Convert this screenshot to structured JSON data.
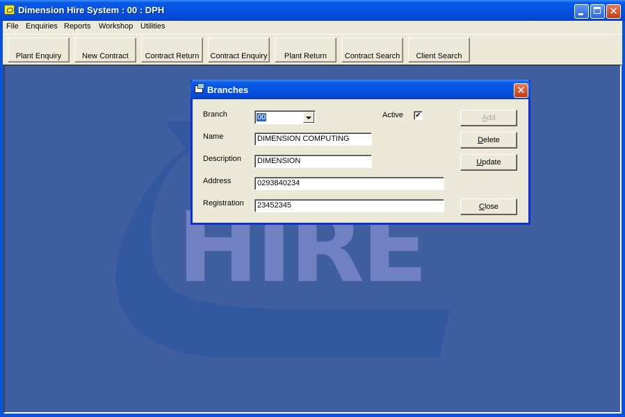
{
  "window": {
    "title": "Dimension Hire System  : 00 : DPH",
    "controls": [
      "minimize",
      "maximize",
      "close"
    ]
  },
  "menu": [
    "File",
    "Enquiries",
    "Reports",
    "Workshop",
    "Utilities"
  ],
  "toolbar": [
    "Plant Enquiry",
    "New Contract",
    "Contract Return",
    "Contract Enquiry",
    "Plant Return",
    "Contract Search",
    "Client Search"
  ],
  "background": {
    "logo_text": "HIRE"
  },
  "dialog": {
    "title": "Branches",
    "fields": {
      "branch": {
        "label": "Branch",
        "value": "00"
      },
      "active": {
        "label": "Active",
        "checked": true,
        "glyph": "✔"
      },
      "name": {
        "label": "Name",
        "value": "DIMENSION COMPUTING"
      },
      "description": {
        "label": "Description",
        "value": "DIMENSION"
      },
      "address": {
        "label": "Address",
        "value": "0293840234"
      },
      "registration": {
        "label": "Registration",
        "value": "23452345"
      }
    },
    "buttons": {
      "add": {
        "mnemonic": "A",
        "rest": "dd",
        "enabled": false
      },
      "delete": {
        "mnemonic": "D",
        "rest": "elete",
        "enabled": true
      },
      "update": {
        "mnemonic": "U",
        "rest": "pdate",
        "enabled": true
      },
      "close": {
        "mnemonic": "C",
        "rest": "lose",
        "enabled": true
      }
    }
  },
  "icons": {
    "close": "✕"
  }
}
